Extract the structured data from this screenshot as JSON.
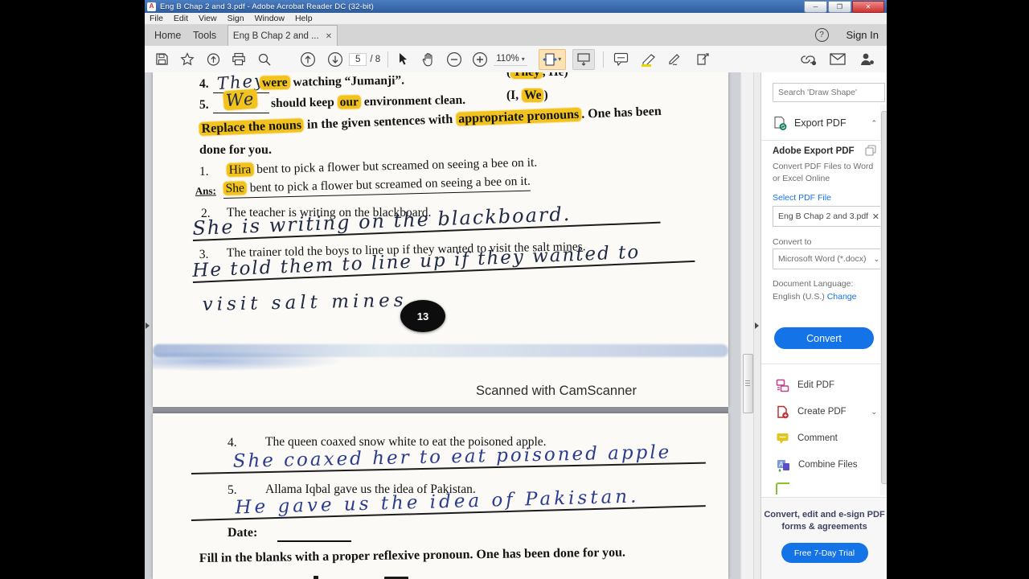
{
  "colors": {
    "accent": "#1473e6",
    "highlight": "#f3c31d",
    "titlebar": "#2f5d9e",
    "ink_page1": "#202945",
    "ink_page2": "#2b3c8f"
  },
  "window": {
    "title": "Eng B Chap 2 and 3.pdf - Adobe Acrobat Reader DC (32-bit)",
    "app_icon_letter": "A",
    "minimize": "─",
    "restore": "❐",
    "close": "✕",
    "menu": {
      "file": "File",
      "edit": "Edit",
      "view": "View",
      "sign": "Sign",
      "window": "Window",
      "help": "Help"
    },
    "tabs": {
      "home": "Home",
      "tools": "Tools",
      "document": "Eng B Chap 2 and ...",
      "close": "✕"
    },
    "help_glyph": "?",
    "sign_in": "Sign In"
  },
  "toolbar": {
    "page_current": "5",
    "page_total": "/ 8",
    "zoom_level": "110%",
    "caret": "▾"
  },
  "doc": {
    "p1": {
      "i4_num": "4.",
      "i4_hand": "They",
      "i4_hl": "were",
      "i4_rest": " watching “Jumanji”.",
      "i4_opt_pre": "(",
      "i4_opt_hl": "They",
      "i4_opt_post": ", He)",
      "i5_num": "5.",
      "i5_hand": "We",
      "i5_pre": "should keep ",
      "i5_hl": "our",
      "i5_post": " environment clean.",
      "i5_opt_pre": "(I, ",
      "i5_opt_hl": "We",
      "i5_opt_post": ")",
      "inst_hl1": "Replace the nouns",
      "inst_mid": " in the given sentences with ",
      "inst_hl2": "appropriate pronouns",
      "inst_end": ". One has been",
      "inst_line2": "done for you.",
      "q1_num": "1.",
      "q1_hl": "Hira",
      "q1_rest": " bent to pick a flower but screamed on seeing a bee on it.",
      "ans_label": "Ans:",
      "ans_hl": "She",
      "ans_rest": " bent to pick a flower but screamed on seeing a bee on it.",
      "q2_num": "2.",
      "q2_text": "The teacher is writing on the blackboard.",
      "hw2": "She is writing on the blackboard.",
      "q3_num": "3.",
      "q3_text": "The trainer told the boys to line up if they wanted to visit the salt mines.",
      "hw3a": "He told them to line up if they wanted to",
      "hw3b": "visit salt mines.",
      "page_number": "13",
      "scanner_credit": "Scanned with CamScanner"
    },
    "p2": {
      "q4_num": "4.",
      "q4_text": "The queen coaxed snow white to eat the poisoned apple.",
      "hw4": "She coaxed her to eat poisoned apple",
      "q5_num": "5.",
      "q5_text": "Allama Iqbal gave us the idea of Pakistan.",
      "hw5": "He gave us the idea of Pakistan.",
      "date_label": "Date:",
      "instruction": "Fill in the blanks with a proper reflexive pronoun. One has been done for you."
    }
  },
  "sidebar": {
    "search_placeholder": "Search 'Draw Shape'",
    "export_header": "Export PDF",
    "collapse_chev": "⌃",
    "adobe_export_title": "Adobe Export PDF",
    "desc_line1": "Convert PDF Files to Word",
    "desc_line2": "or Excel Online",
    "select_file_link": "Select PDF File",
    "file_chip": "Eng B Chap 2 and 3.pdf",
    "chip_close": "✕",
    "convert_to_label": "Convert to",
    "format_value": "Microsoft Word (*.docx)",
    "format_chev": "⌄",
    "doc_lang_label": "Document Language:",
    "lang_value": "English (U.S.)",
    "change_link": "Change",
    "convert_button": "Convert",
    "tools": [
      {
        "label": "Edit PDF"
      },
      {
        "label": "Create PDF",
        "chev": "⌄"
      },
      {
        "label": "Comment"
      },
      {
        "label": "Combine Files"
      }
    ],
    "promo_line1": "Convert, edit and e-sign PDF",
    "promo_line2": "forms & agreements",
    "trial_button": "Free 7-Day Trial"
  }
}
